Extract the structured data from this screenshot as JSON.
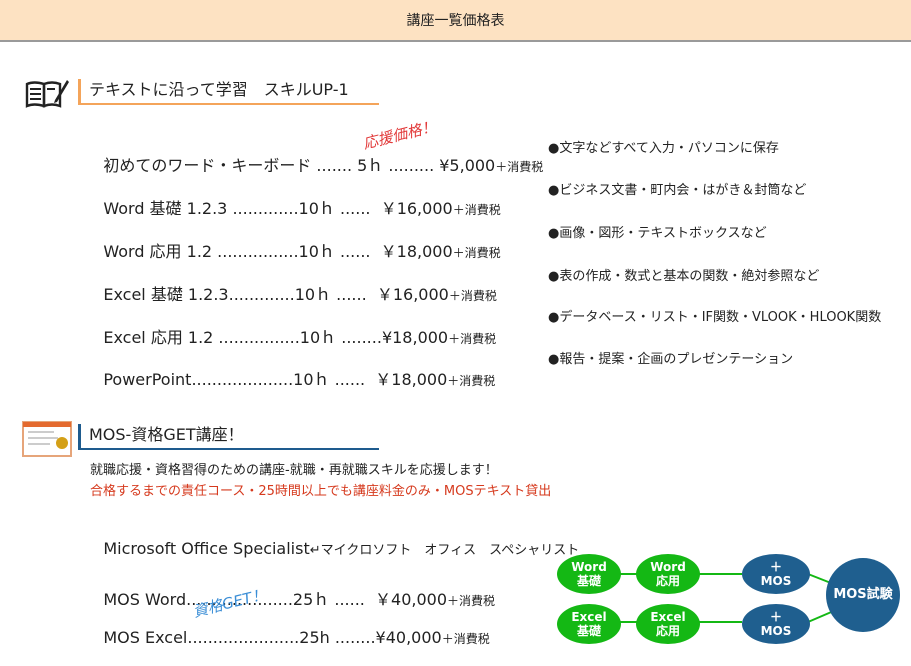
{
  "header": {
    "title": "講座一覧価格表"
  },
  "section1": {
    "title": "テキストに沿って学習　スキルUP-1",
    "icon": "notebook-pencil-icon",
    "stamp": "応援価格！",
    "courses": [
      {
        "line": "初めてのワード・キーボード ....... 5ｈ ......... ¥5,000",
        "tax": "＋消費税",
        "note": "●文字などすべて入力・パソコンに保存"
      },
      {
        "line": "Word 基礎 1.2.3 .............10ｈ ......  ￥16,000",
        "tax": "＋消費税",
        "note": "●ビジネス文書・町内会・はがき＆封筒など"
      },
      {
        "line": "Word 応用 1.2 ................10ｈ ......  ￥18,000",
        "tax": "＋消費税",
        "note": "●画像・図形・テキストボックスなど"
      },
      {
        "line": "Excel 基礎 1.2.3.............10ｈ ......  ￥16,000",
        "tax": "＋消費税",
        "note": "●表の作成・数式と基本の関数・絶対参照など"
      },
      {
        "line": "Excel 応用 1.2 ................10ｈ ........¥18,000",
        "tax": "＋消費税",
        "note": "●データベース・リスト・IF関数・VLOOK・HLOOK関数"
      },
      {
        "line": "PowerPoint....................10ｈ ......  ￥18,000",
        "tax": "＋消費税",
        "note": "●報告・提案・企画のプレゼンテーション"
      }
    ]
  },
  "section2": {
    "title": "MOS-資格GET講座！",
    "icon": "certificate-icon",
    "desc1": "就職応援・資格習得のための講座-就職・再就職スキルを応援します！",
    "desc2": "合格するまでの責任コース・25時間以上でも講座料金のみ・MOSテキスト貸出",
    "spec": "Microsoft Office Specialist",
    "spec_kana": "↵マイクロソフト　オフィス　スペシャリスト",
    "stamp": "資格GET！",
    "courses": [
      {
        "line": "MOS Word.....................25ｈ ......  ￥40,000",
        "tax": "＋消費税"
      },
      {
        "line": "MOS Excel......................25h ........¥40,000",
        "tax": "＋消費税"
      }
    ]
  },
  "diagram": {
    "word_basic": [
      "Word",
      "基礎"
    ],
    "word_adv": [
      "Word",
      "応用"
    ],
    "excel_basic": [
      "Excel",
      "基礎"
    ],
    "excel_adv": [
      "Excel",
      "応用"
    ],
    "plus_mos_1": [
      "＋",
      "MOS"
    ],
    "plus_mos_2": [
      "＋",
      "MOS"
    ],
    "exam": "MOS試験",
    "colors": {
      "green": "#14b814",
      "navy": "#1f5f8f"
    }
  }
}
